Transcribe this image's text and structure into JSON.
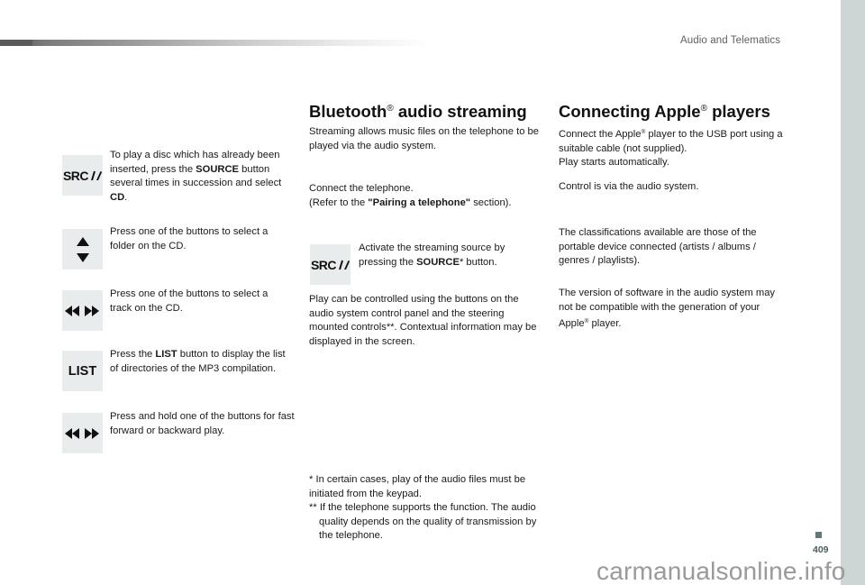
{
  "header": {
    "section_title": "Audio and Telematics"
  },
  "left_column": {
    "items": [
      {
        "icon": "src-phone-icon",
        "icon_text": "SRC",
        "text_parts": [
          "To play a disc which has already been inserted, press the ",
          "SOURCE",
          " button several times in succession and select ",
          "CD",
          "."
        ]
      },
      {
        "icon": "up-down-arrows-icon",
        "text": "Press one of the buttons to select a folder on the CD."
      },
      {
        "icon": "skip-back-forward-icon",
        "text": "Press one of the buttons to select a track on the CD."
      },
      {
        "icon": "list-icon",
        "icon_text": "LIST",
        "text_parts": [
          "Press the ",
          "LIST",
          " button to display the list of directories of the MP3 compilation."
        ]
      },
      {
        "icon": "skip-back-forward-icon",
        "text": "Press and hold one of the buttons for fast forward or backward play."
      }
    ]
  },
  "bluetooth": {
    "title": "Bluetooth",
    "title_mark": "®",
    "title_rest": " audio streaming",
    "p1": "Streaming allows music files on the telephone to be played via the audio system.",
    "p2_line1": "Connect the telephone.",
    "p2_parts": [
      "(Refer to the ",
      "\"Pairing a telephone\"",
      " section)."
    ],
    "activate": {
      "icon_text": "SRC",
      "parts": [
        "Activate the streaming source by pressing the ",
        "SOURCE",
        "* button."
      ]
    },
    "p3": "Play can be controlled using the buttons on the audio system control panel and the steering mounted controls**. Contextual information may be displayed in the screen.",
    "footnotes": [
      {
        "mark": "*",
        "text": "In certain cases, play of the audio files must be initiated from the keypad."
      },
      {
        "mark": "**",
        "text": "If the telephone supports the function. The audio quality depends on the quality of transmission by the telephone."
      }
    ]
  },
  "apple": {
    "title": "Connecting Apple",
    "title_mark": "®",
    "title_rest": " players",
    "p1_a": "Connect the Apple",
    "p1_mark": "®",
    "p1_b": " player to the USB port using a suitable cable (not supplied).",
    "p1_c": "Play starts automatically.",
    "p2": "Control is via the audio system.",
    "p3": "The classifications available are those of the portable device connected (artists / albums / genres / playlists).",
    "p4_a": "The version of software in the audio system may not be compatible with the generation of your Apple",
    "p4_mark": "®",
    "p4_b": " player."
  },
  "footer": {
    "page_number": "409",
    "watermark": "carmanualsonline.info"
  },
  "colors": {
    "side_strip": "#cdd6d5",
    "icon_bg": "#e9ecec",
    "page_num": "#4d5a5a"
  }
}
